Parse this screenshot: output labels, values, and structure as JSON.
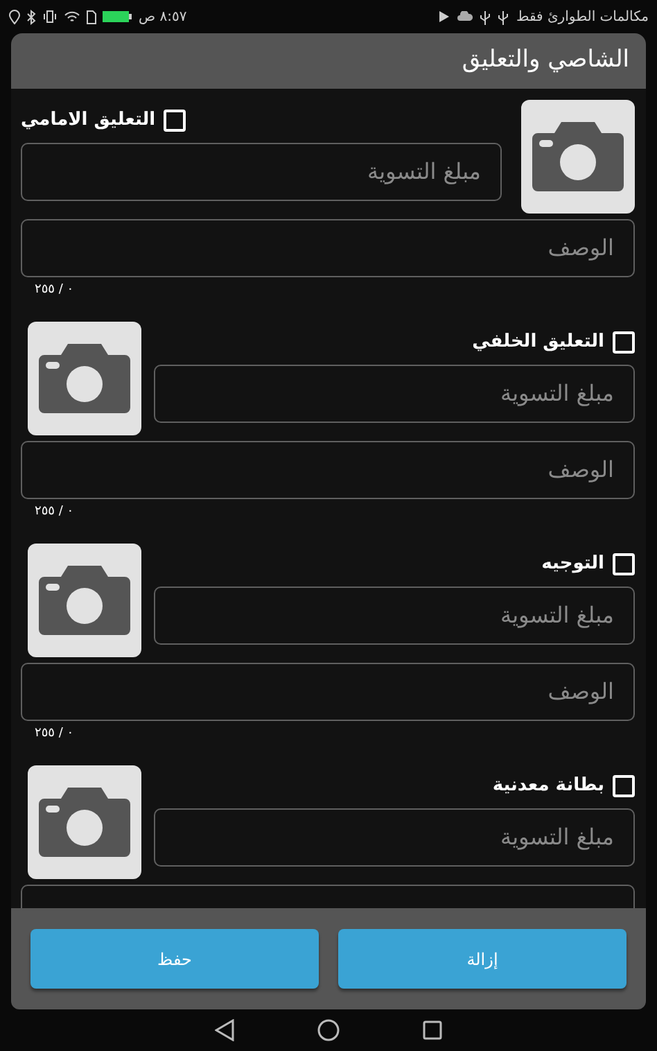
{
  "status_bar": {
    "time": "٨:٥٧ ص",
    "carrier": "مكالمات الطوارئ فقط"
  },
  "dialog": {
    "title": "الشاصي والتعليق"
  },
  "sections": [
    {
      "kind": "photo_right",
      "label": "التعليق الامامي",
      "checked": false,
      "amount_placeholder": "مبلغ التسوية",
      "description_placeholder": "الوصف",
      "counter": "٠ / ٢٥٥"
    },
    {
      "kind": "photo_left",
      "label": "التعليق الخلفي",
      "checked": false,
      "amount_placeholder": "مبلغ التسوية",
      "description_placeholder": "الوصف",
      "counter": "٠ / ٢٥٥"
    },
    {
      "kind": "photo_left",
      "label": "التوجيه",
      "checked": false,
      "amount_placeholder": "مبلغ التسوية",
      "description_placeholder": "الوصف",
      "counter": "٠ / ٢٥٥"
    },
    {
      "kind": "photo_left",
      "label": "بطانة معدنية",
      "checked": false,
      "amount_placeholder": "مبلغ التسوية"
    }
  ],
  "buttons": [
    {
      "label": "إزالة"
    },
    {
      "label": "حفظ"
    }
  ]
}
